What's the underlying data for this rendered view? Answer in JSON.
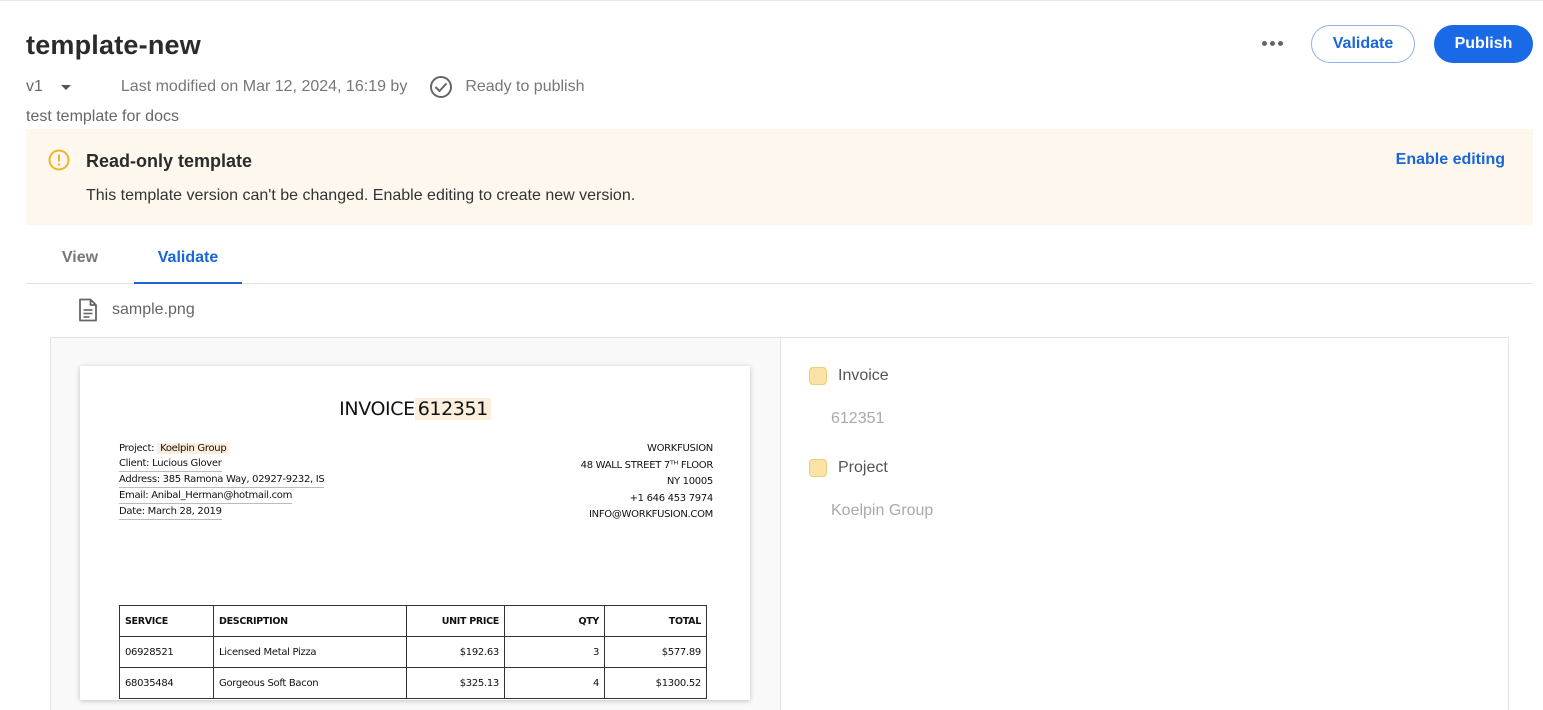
{
  "header": {
    "title": "template-new",
    "version": "v1",
    "last_modified": "Last modified on Mar 12, 2024, 16:19 by",
    "status": "Ready to publish",
    "description": "test template for docs",
    "validate_label": "Validate",
    "publish_label": "Publish"
  },
  "banner": {
    "title": "Read-only template",
    "text": "This template version can't be changed. Enable editing to create new version.",
    "action": "Enable editing"
  },
  "tabs": [
    {
      "label": "View",
      "active": false
    },
    {
      "label": "Validate",
      "active": true
    }
  ],
  "file": {
    "name": "sample.png"
  },
  "document": {
    "title_prefix": "INVOICE",
    "invoice_number": "612351",
    "client_info": {
      "project_label": "Project:",
      "project_value": "Koelpin Group",
      "client": "Client: Lucious Glover",
      "address": "Address: 385 Ramona Way, 02927-9232, IS",
      "email": "Email: Anibal_Herman@hotmail.com",
      "date": "Date: March 28, 2019"
    },
    "company": {
      "name": "WORKFUSION",
      "street": "48 WALL STREET 7ᵀᴴ FLOOR",
      "city": "NY 10005",
      "phone": "+1 646 453 7974",
      "email": "INFO@WORKFUSION.COM"
    },
    "table": {
      "headers": [
        "SERVICE",
        "DESCRIPTION",
        "UNIT PRICE",
        "QTY",
        "TOTAL"
      ],
      "rows": [
        [
          "06928521",
          "Licensed Metal Pizza",
          "$192.63",
          "3",
          "$577.89"
        ],
        [
          "68035484",
          "Gorgeous Soft Bacon",
          "$325.13",
          "4",
          "$1300.52"
        ]
      ]
    }
  },
  "fields": [
    {
      "label": "Invoice",
      "value": "612351"
    },
    {
      "label": "Project",
      "value": "Koelpin Group"
    }
  ],
  "colors": {
    "accent": "#1a6ae8",
    "banner_bg": "#fdf7ee",
    "warning": "#f0b429",
    "highlight": "#fbeedc",
    "field_chip": "#fbe3a8"
  }
}
